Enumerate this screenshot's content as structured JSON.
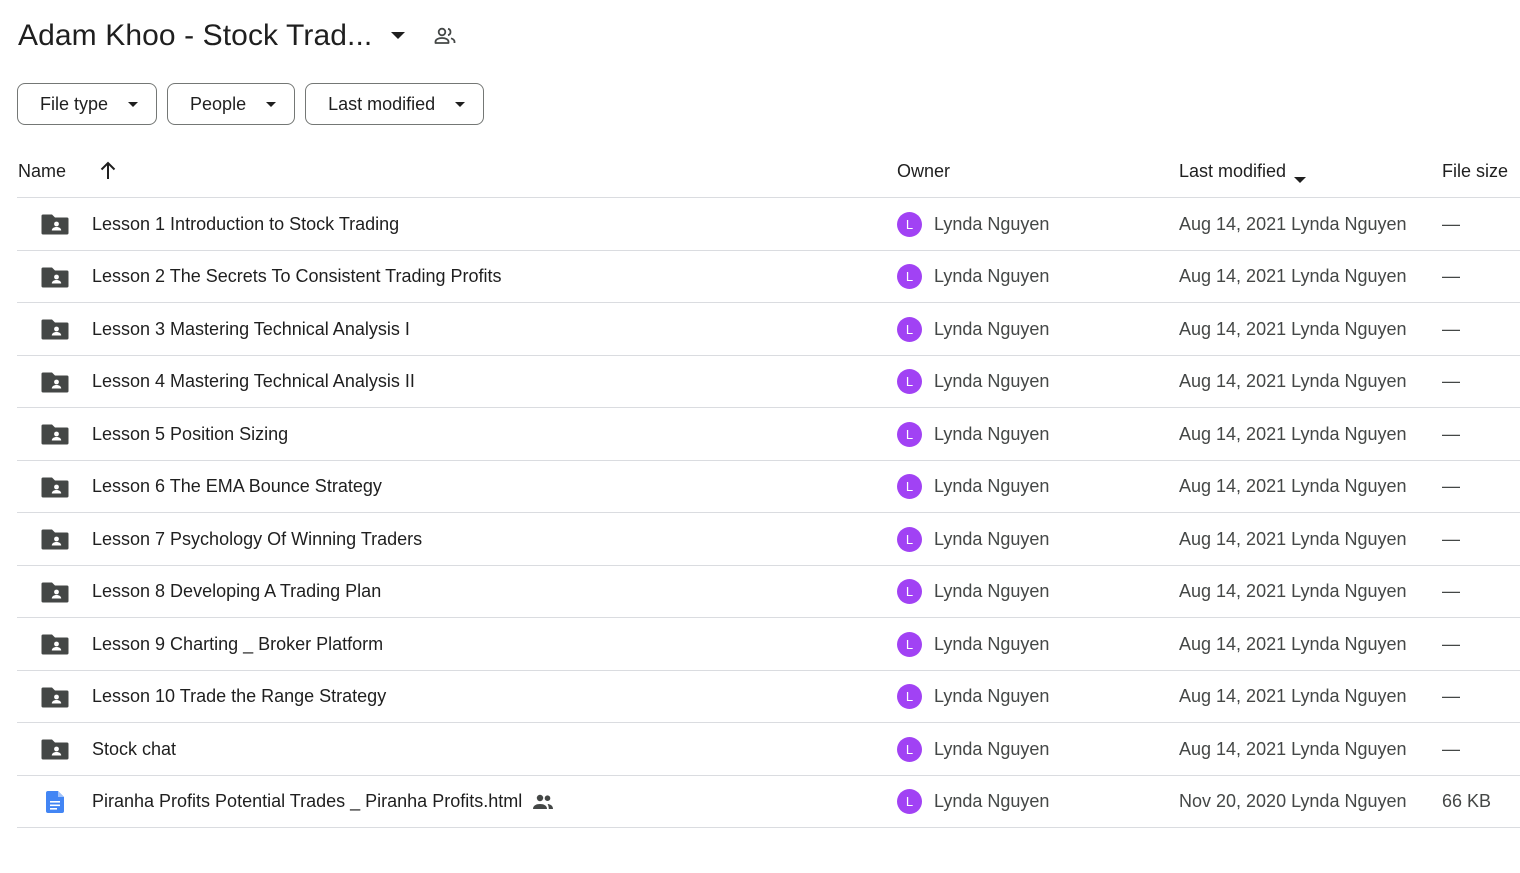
{
  "header": {
    "title": "Adam Khoo - Stock Trad...",
    "title_icon": "chevron-down-icon",
    "share_icon": "shared-people-icon"
  },
  "filters": [
    {
      "label": "File type"
    },
    {
      "label": "People"
    },
    {
      "label": "Last modified"
    }
  ],
  "table": {
    "columns": {
      "name": "Name",
      "owner": "Owner",
      "last_modified": "Last modified",
      "file_size": "File size"
    },
    "rows": [
      {
        "type": "shared-folder",
        "name": "Lesson 1 Introduction to Stock Trading",
        "owner_initial": "L",
        "owner": "Lynda Nguyen",
        "date": "Aug 14, 2021",
        "modified_by": "Lynda Nguyen",
        "size": "—"
      },
      {
        "type": "shared-folder",
        "name": "Lesson 2 The Secrets To Consistent Trading Profits",
        "owner_initial": "L",
        "owner": "Lynda Nguyen",
        "date": "Aug 14, 2021",
        "modified_by": "Lynda Nguyen",
        "size": "—"
      },
      {
        "type": "shared-folder",
        "name": "Lesson 3 Mastering Technical Analysis I",
        "owner_initial": "L",
        "owner": "Lynda Nguyen",
        "date": "Aug 14, 2021",
        "modified_by": "Lynda Nguyen",
        "size": "—"
      },
      {
        "type": "shared-folder",
        "name": "Lesson 4 Mastering Technical Analysis II",
        "owner_initial": "L",
        "owner": "Lynda Nguyen",
        "date": "Aug 14, 2021",
        "modified_by": "Lynda Nguyen",
        "size": "—"
      },
      {
        "type": "shared-folder",
        "name": "Lesson 5 Position Sizing",
        "owner_initial": "L",
        "owner": "Lynda Nguyen",
        "date": "Aug 14, 2021",
        "modified_by": "Lynda Nguyen",
        "size": "—"
      },
      {
        "type": "shared-folder",
        "name": "Lesson 6 The EMA Bounce Strategy",
        "owner_initial": "L",
        "owner": "Lynda Nguyen",
        "date": "Aug 14, 2021",
        "modified_by": "Lynda Nguyen",
        "size": "—"
      },
      {
        "type": "shared-folder",
        "name": "Lesson 7 Psychology Of Winning Traders",
        "owner_initial": "L",
        "owner": "Lynda Nguyen",
        "date": "Aug 14, 2021",
        "modified_by": "Lynda Nguyen",
        "size": "—"
      },
      {
        "type": "shared-folder",
        "name": "Lesson 8 Developing A Trading Plan",
        "owner_initial": "L",
        "owner": "Lynda Nguyen",
        "date": "Aug 14, 2021",
        "modified_by": "Lynda Nguyen",
        "size": "—"
      },
      {
        "type": "shared-folder",
        "name": "Lesson 9 Charting _ Broker Platform",
        "owner_initial": "L",
        "owner": "Lynda Nguyen",
        "date": "Aug 14, 2021",
        "modified_by": "Lynda Nguyen",
        "size": "—"
      },
      {
        "type": "shared-folder",
        "name": "Lesson 10 Trade the Range Strategy",
        "owner_initial": "L",
        "owner": "Lynda Nguyen",
        "date": "Aug 14, 2021",
        "modified_by": "Lynda Nguyen",
        "size": "—"
      },
      {
        "type": "shared-folder",
        "name": "Stock chat",
        "owner_initial": "L",
        "owner": "Lynda Nguyen",
        "date": "Aug 14, 2021",
        "modified_by": "Lynda Nguyen",
        "size": "—"
      },
      {
        "type": "google-doc",
        "name": "Piranha Profits Potential Trades _ Piranha Profits.html",
        "shared": true,
        "owner_initial": "L",
        "owner": "Lynda Nguyen",
        "date": "Nov 20, 2020",
        "modified_by": "Lynda Nguyen",
        "size": "66 KB"
      }
    ]
  },
  "colors": {
    "avatar": "#a142f4",
    "folder_icon": "#444746",
    "doc_icon": "#4285f4",
    "divider": "#dadce0"
  }
}
